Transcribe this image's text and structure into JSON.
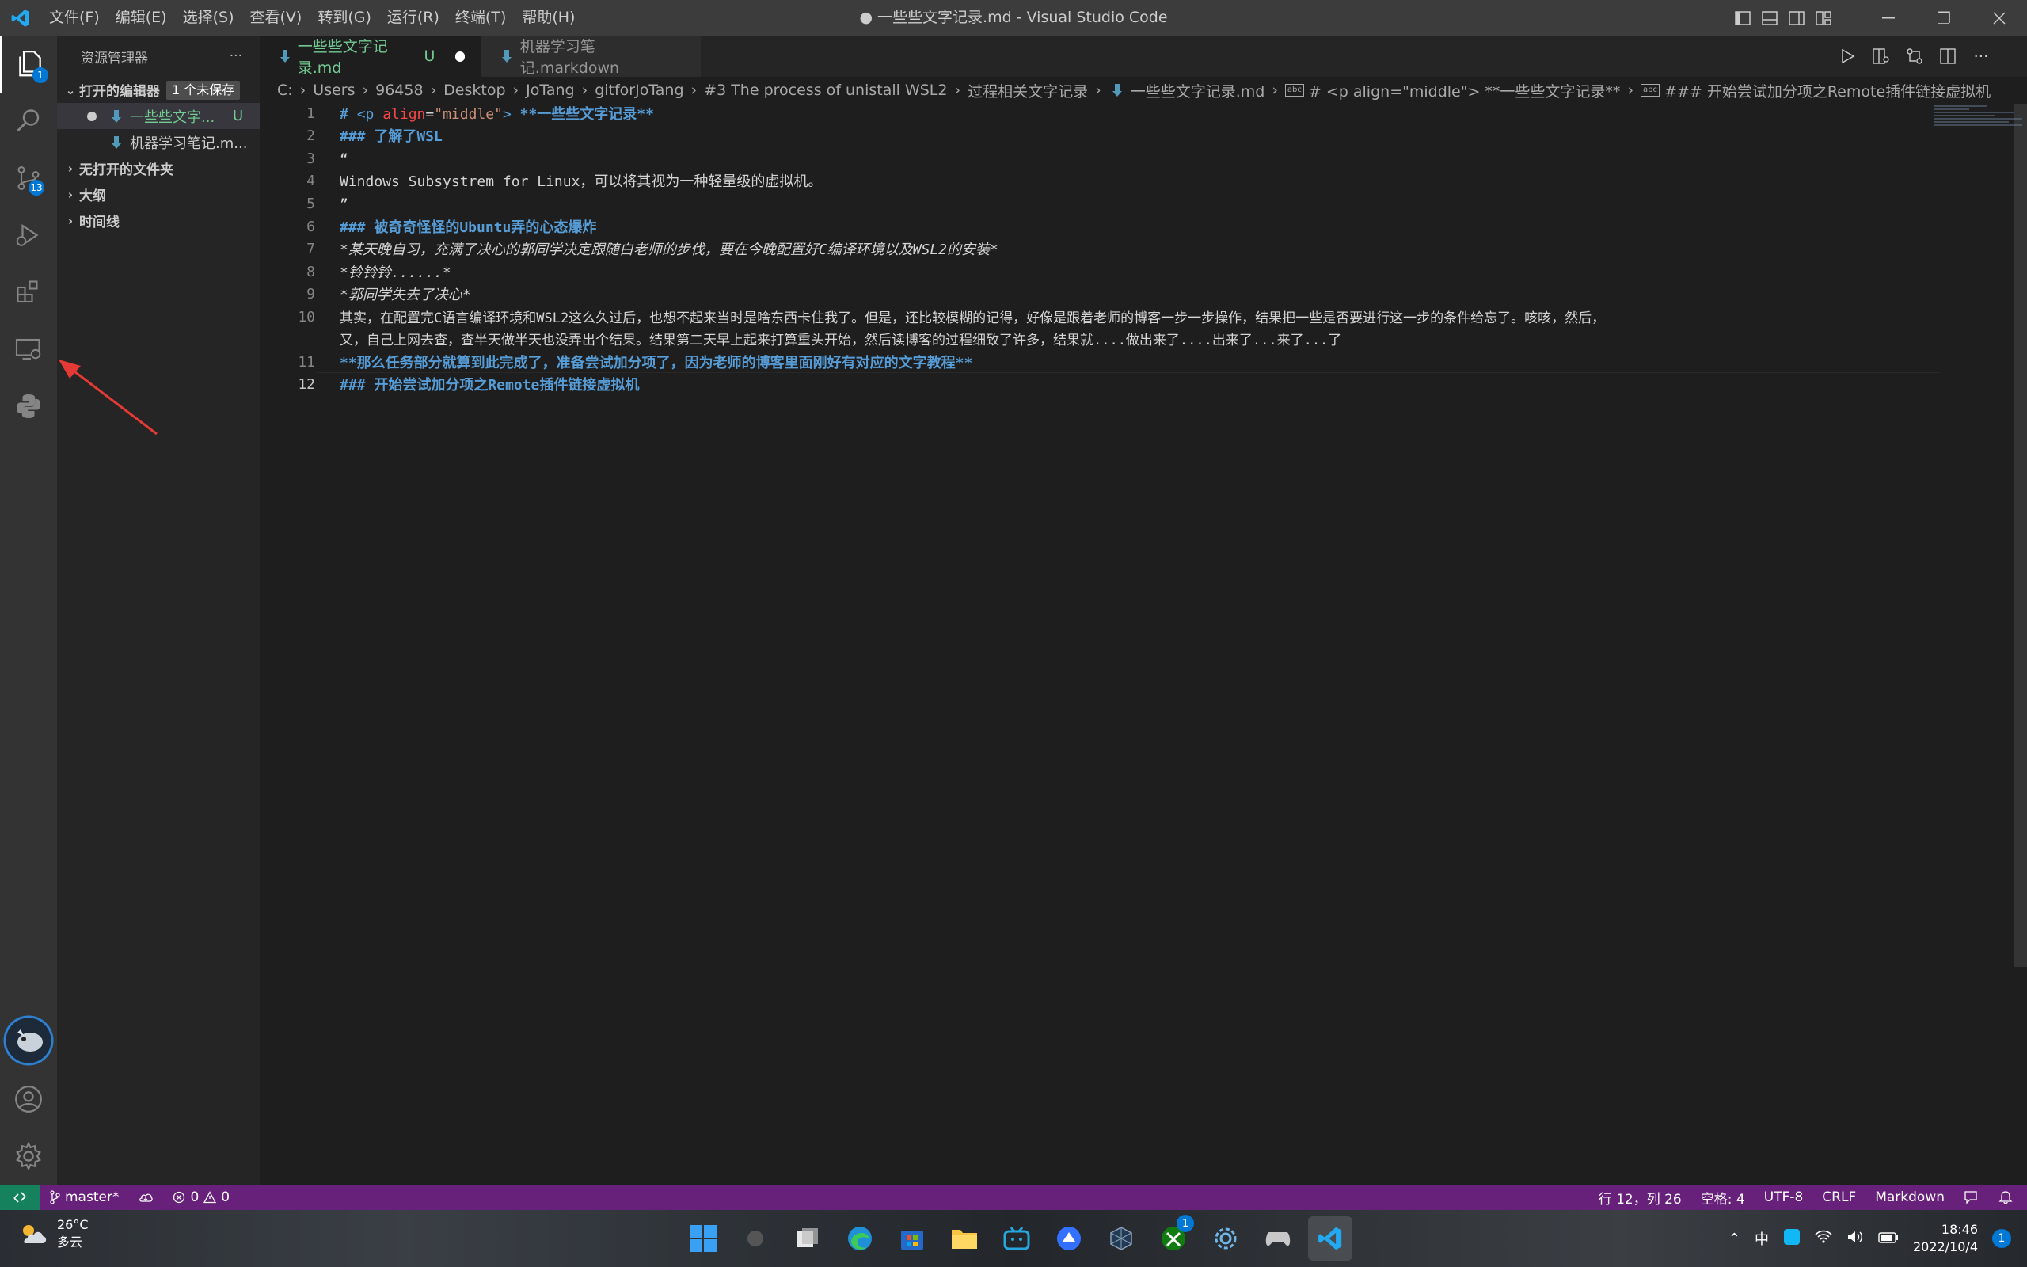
{
  "titlebar": {
    "menu": [
      "文件(F)",
      "编辑(E)",
      "选择(S)",
      "查看(V)",
      "转到(G)",
      "运行(R)",
      "终端(T)",
      "帮助(H)"
    ],
    "title": "● 一些些文字记录.md - Visual Studio Code",
    "restore_glyph": "❐"
  },
  "activitybar": {
    "explorer_badge": "1",
    "scm_badge": "13"
  },
  "sidebar": {
    "header": "资源管理器",
    "more": "···",
    "open_editors_label": "打开的编辑器",
    "unsaved_badge": "1 个未保存",
    "open_editors": [
      {
        "name": "一些些文字...",
        "status": "U"
      },
      {
        "name": "机器学习笔记.m..."
      }
    ],
    "no_folder_label": "无打开的文件夹",
    "outline_label": "大纲",
    "timeline_label": "时间线"
  },
  "tabs": [
    {
      "label": "一些些文字记录.md",
      "status": "U"
    },
    {
      "label": "机器学习笔记.markdown"
    }
  ],
  "breadcrumb": {
    "parts": [
      "C:",
      "Users",
      "96458",
      "Desktop",
      "JoTang",
      "gitforJoTang",
      "#3 The process of unistall WSL2",
      "过程相关文字记录"
    ],
    "file": "一些些文字记录.md",
    "sym1": "# <p align=\"middle\"> **一些些文字记录**",
    "sym2": "### 开始尝试加分项之Remote插件链接虚拟机"
  },
  "editor": {
    "line_numbers": [
      "1",
      "2",
      "3",
      "4",
      "5",
      "6",
      "7",
      "8",
      "9",
      "10",
      "",
      "11",
      "12"
    ],
    "current_line": "12",
    "lines": {
      "l1_hash": "# ",
      "l1_tag_open": "<p ",
      "l1_attr": "align",
      "l1_eq": "=",
      "l1_str": "\"middle\"",
      "l1_tag_close": "> ",
      "l1_bold": "**一些些文字记录**",
      "l2": "### 了解了WSL",
      "l3": "“",
      "l4": "Windows Subsystrem for Linux，可以将其视为一种轻量级的虚拟机。",
      "l5": "”",
      "l6": "### 被奇奇怪怪的Ubuntu弄的心态爆炸",
      "l7": "*某天晚自习，充满了决心的郭同学决定跟随白老师的步伐，要在今晚配置好C编译环境以及WSL2的安装*",
      "l8": "*铃铃铃......*",
      "l9": "*郭同学失去了决心*",
      "l10a": "其实，在配置完C语言编译环境和WSL2这么久过后，也想不起来当时是啥东西卡住我了。但是，还比较模糊的记得，好像是跟着老师的博客一步一步操作，结果把一些是否要进行这一步的条件给忘了。咳咳，然后，",
      "l10b": "又，自己上网去查，查半天做半天也没弄出个结果。结果第二天早上起来打算重头开始，然后读博客的过程细致了许多，结果就....做出来了....出来了...来了...了",
      "l11": "**那么任务部分就算到此完成了，准备尝试加分项了，因为老师的博客里面刚好有对应的文字教程**",
      "l12": "### 开始尝试加分项之Remote插件链接虚拟机"
    }
  },
  "statusbar": {
    "branch": "master*",
    "errors": "0",
    "warnings": "0",
    "position": "行 12，列 26",
    "spaces": "空格: 4",
    "encoding": "UTF-8",
    "eol": "CRLF",
    "language": "Markdown"
  },
  "taskbar": {
    "temperature": "26°C",
    "weather": "多云",
    "ime": "中",
    "clock_time": "18:46",
    "clock_date": "2022/10/4",
    "xbox_badge": "1",
    "notifications": "1"
  },
  "colors": {
    "statusbar": "#68217a",
    "accent": "#0078d4",
    "heading": "#569cd6",
    "annotation_arrow": "#e53935"
  }
}
